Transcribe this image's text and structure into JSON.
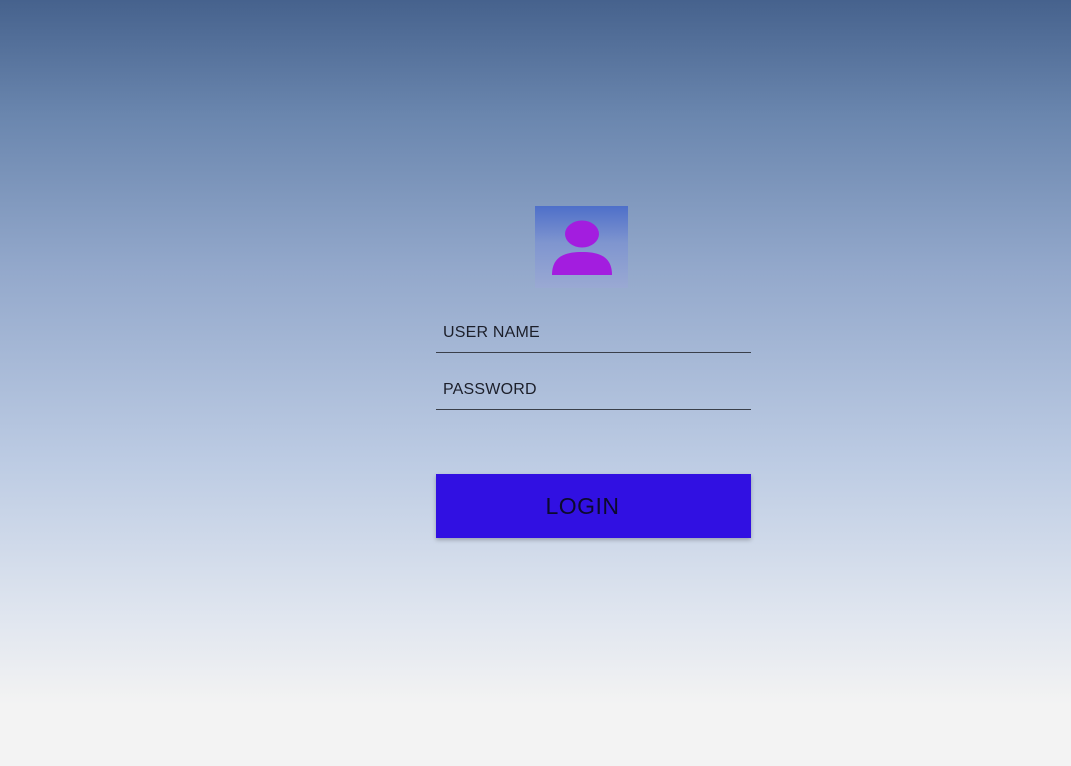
{
  "login": {
    "avatar_icon": "user-icon",
    "username_placeholder": "USER NAME",
    "password_placeholder": "PASSWORD",
    "login_label": "LOGIN"
  },
  "colors": {
    "button": "#3110e2",
    "avatar_figure": "#a31ddf",
    "background_top": "#46628d",
    "background_bottom": "#f3f3f3"
  }
}
